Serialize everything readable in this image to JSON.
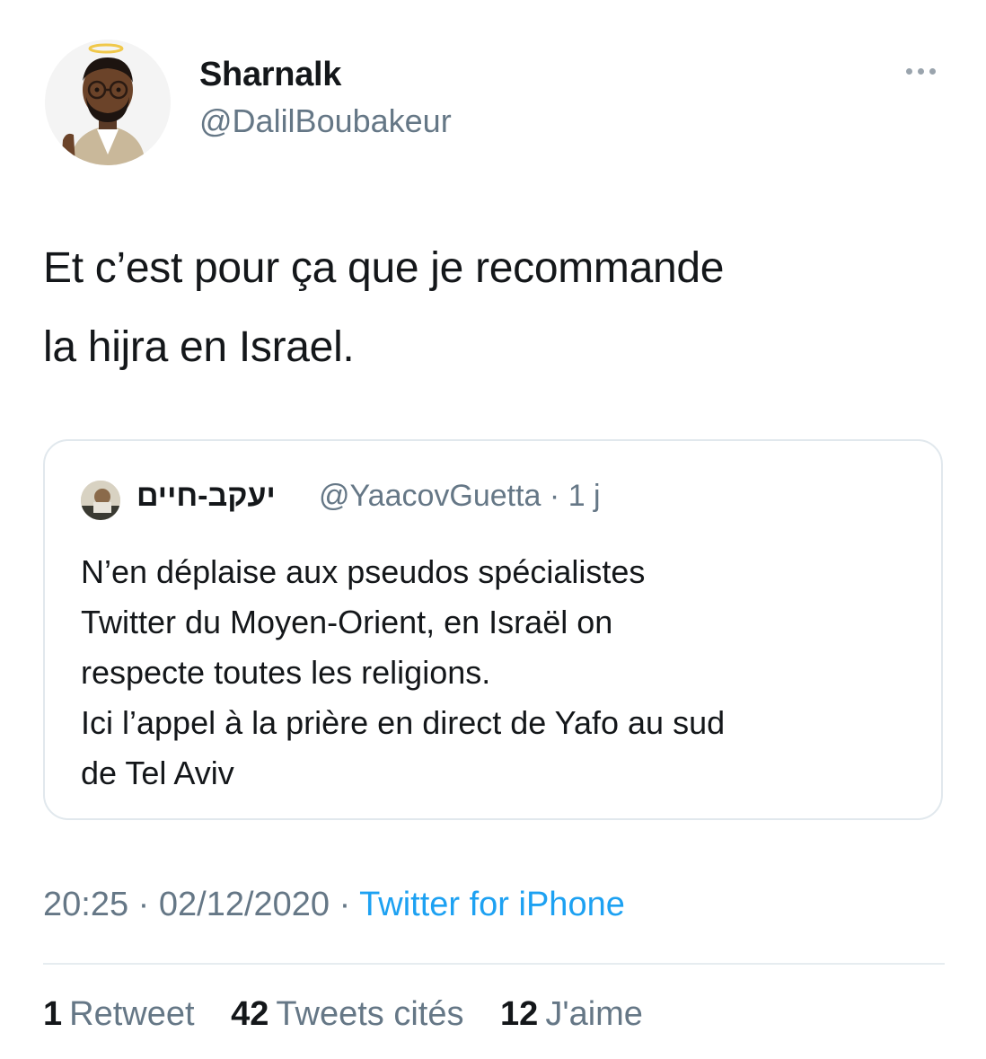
{
  "author": {
    "name": "Sharnalk",
    "handle": "@DalilBoubakeur"
  },
  "tweet": {
    "text": "Et c’est pour ça que je recommande\nla hijra en Israel."
  },
  "quoted_tweet": {
    "name": "יעקב-חיים",
    "handle": "@YaacovGuetta",
    "separator": "·",
    "age": "1 j",
    "text": "N’en déplaise aux pseudos spécialistes\nTwitter du Moyen-Orient, en Israël on\nrespecte toutes les religions.\nIci l’appel à la prière en direct de Yafo au sud\nde Tel Aviv"
  },
  "meta": {
    "time": "20:25",
    "separator": "·",
    "date": "02/12/2020",
    "source": "Twitter for iPhone"
  },
  "stats": [
    {
      "count": "1",
      "label": "Retweet"
    },
    {
      "count": "42",
      "label": "Tweets cités"
    },
    {
      "count": "12",
      "label": "J'aime"
    }
  ],
  "icons": {
    "more": "more-dots-icon"
  },
  "colors": {
    "link": "#1da1f2",
    "secondary_text": "#657786",
    "border": "#e1e8ed"
  }
}
